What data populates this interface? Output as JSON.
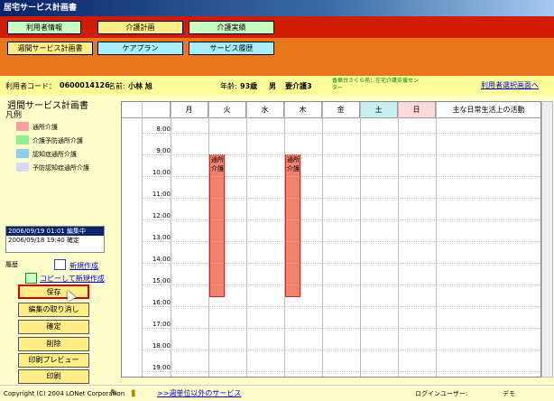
{
  "window": {
    "title": "居宅サービス計画書"
  },
  "top_menu": {
    "user_info": "利用者情報",
    "care_plan": "介護計画",
    "care_results": "介護実績"
  },
  "sub_menu": {
    "weekly_plan": "週間サービス計画書",
    "care_plan": "ケアプラン",
    "service_history": "サービス履歴"
  },
  "user": {
    "code_label": "利用者コード：",
    "code": "0600014126",
    "name_label": "名前:",
    "name": "小林 旭",
    "age_label": "年齢:",
    "age": "93歳",
    "sex": "男",
    "care_level": "要介護3",
    "provider": "香華台さくら苑：在宅介護支援センター",
    "select_link": "利用者選択画面へ"
  },
  "left": {
    "page_title": "週間サービス計画書",
    "legend_title": "凡例",
    "legend": [
      {
        "label": "通所介護",
        "color": "#f8a0a0"
      },
      {
        "label": "介護予防通所介護",
        "color": "#90f090"
      },
      {
        "label": "認知症通所介護",
        "color": "#8ad0f0"
      },
      {
        "label": "予防認知症通所介護",
        "color": "#d8d8f8"
      }
    ],
    "history": [
      "2006/09/19 01:01 編集中",
      "2006/09/18 19:40 確定"
    ],
    "history_label": "履歴",
    "new_create": "新規作成",
    "copy_create": "コピーして新規作成",
    "buttons": {
      "save": "保存",
      "undo": "編集の取り消し",
      "confirm": "確定",
      "delete": "削除",
      "print_preview": "印刷プレビュー",
      "print": "印刷"
    }
  },
  "schedule": {
    "days": [
      "月",
      "火",
      "水",
      "木",
      "金",
      "土",
      "日"
    ],
    "activities_header": "主な日常生活上の活動",
    "hours": [
      "8:00",
      "9:00",
      "10:00",
      "11:00",
      "12:00",
      "13:00",
      "14:00",
      "15:00",
      "16:00",
      "17:00",
      "18:00",
      "19:00"
    ],
    "block_label": "通所介護"
  },
  "footer": {
    "copyright": "Copyright (C) 2004 LONet Corporation",
    "other_services": ">>週単位以外のサービス",
    "login_label": "ログインユーザー:",
    "login_user": "デモ"
  },
  "colors": {
    "red_menu": "#d01c00",
    "orange_menu": "#e8761c",
    "block": "#f08070"
  }
}
